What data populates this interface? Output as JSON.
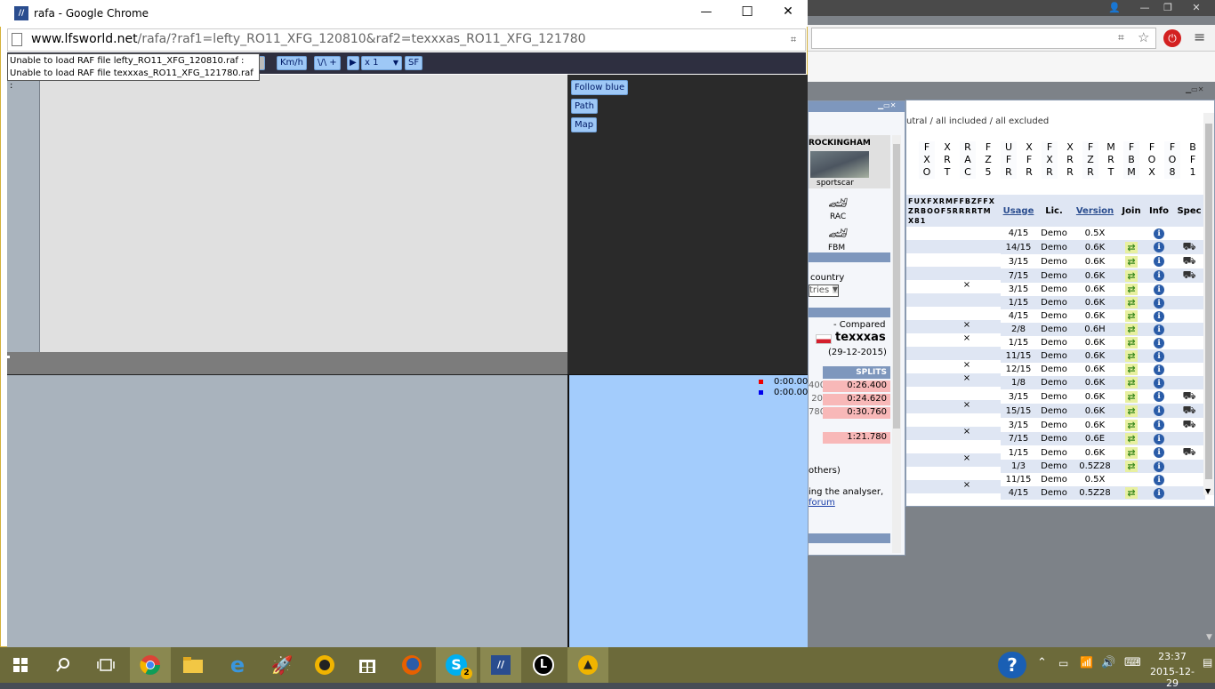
{
  "main_window": {
    "title": "rafa - Google Chrome",
    "url_host": "www.lfsworld.net",
    "url_path": "/rafa/?raf1=lefty_RO11_XFG_120810&raf2=texxxas_RO11_XFG_121780",
    "minimize": "—",
    "maximize": "☐",
    "close": "✕"
  },
  "errors": [
    "Unable to load RAF file lefty_RO11_XFG_120810.raf :",
    "Unable to load RAF file texxxas_RO11_XFG_121780.raf :"
  ],
  "toolbar": {
    "speed_unit": "Km/h",
    "graph_btn": "\\/\\ +",
    "play": "▶",
    "speed_select": "x 1",
    "sf": "SF"
  },
  "right_panel": {
    "follow_blue": "Follow blue",
    "path": "Path",
    "map": "Map",
    "timer_red": "0:00.00",
    "timer_blue": "0:00.00"
  },
  "bg_page": {
    "filter_text": "utral / all included / all excluded",
    "track_name": "ROCKINGHAM",
    "track_config": "sportscar",
    "car1": "RAC",
    "car2": "FBM",
    "country_label": "country",
    "country_select": "tries",
    "compared_label": "- Compared",
    "player_name": "texxxas",
    "date": "(29-12-2015)",
    "splits_header": "SPLITS",
    "splits_left": [
      "400",
      "20",
      "780"
    ],
    "splits": [
      "0:26.400",
      "0:24.620",
      "0:30.760"
    ],
    "total": "1:21.780",
    "others_text": "others)",
    "analyser_text": "ing the analyser,",
    "forum_link": "forum",
    "car_cols": [
      [
        "F",
        "X",
        "O"
      ],
      [
        "X",
        "R",
        "T"
      ],
      [
        "R",
        "A",
        "C"
      ],
      [
        "F",
        "Z",
        "5"
      ],
      [
        "U",
        "F",
        "R"
      ],
      [
        "X",
        "F",
        "R"
      ],
      [
        "F",
        "X",
        "R"
      ],
      [
        "X",
        "R",
        "R"
      ],
      [
        "F",
        "Z",
        "R"
      ],
      [
        "M",
        "R",
        "T"
      ],
      [
        "F",
        "B",
        "M"
      ],
      [
        "F",
        "O",
        "X"
      ],
      [
        "F",
        "O",
        "8"
      ],
      [
        "B",
        "F",
        "1"
      ]
    ],
    "small_hdr": [
      "F",
      "U",
      "X",
      "F",
      "X",
      "R",
      "M",
      "F",
      "F",
      "B",
      "Z",
      "F",
      "F",
      "X",
      "Z",
      "R",
      "B",
      "O",
      "O",
      "F",
      "5",
      "R",
      "R",
      "R",
      "R",
      "T",
      "M",
      "X",
      "8",
      "1"
    ],
    "col_usage": "Usage",
    "col_lic": "Lic.",
    "col_version": "Version",
    "col_join": "Join",
    "col_info": "Info",
    "col_spec": "Spec",
    "rows": [
      {
        "x": "",
        "usage": "4/15",
        "lic": "Demo",
        "ver": "0.5X",
        "join": false,
        "spec": false
      },
      {
        "x": "",
        "usage": "14/15",
        "lic": "Demo",
        "ver": "0.6K",
        "join": true,
        "spec": true
      },
      {
        "x": "",
        "usage": "3/15",
        "lic": "Demo",
        "ver": "0.6K",
        "join": true,
        "spec": true
      },
      {
        "x": "",
        "usage": "7/15",
        "lic": "Demo",
        "ver": "0.6K",
        "join": true,
        "spec": true
      },
      {
        "x": "×",
        "usage": "3/15",
        "lic": "Demo",
        "ver": "0.6K",
        "join": true,
        "spec": false
      },
      {
        "x": "",
        "usage": "1/15",
        "lic": "Demo",
        "ver": "0.6K",
        "join": true,
        "spec": false
      },
      {
        "x": "",
        "usage": "4/15",
        "lic": "Demo",
        "ver": "0.6K",
        "join": true,
        "spec": false
      },
      {
        "x": "×",
        "usage": "2/8",
        "lic": "Demo",
        "ver": "0.6H",
        "join": true,
        "spec": false
      },
      {
        "x": "×",
        "usage": "1/15",
        "lic": "Demo",
        "ver": "0.6K",
        "join": true,
        "spec": false
      },
      {
        "x": "",
        "usage": "11/15",
        "lic": "Demo",
        "ver": "0.6K",
        "join": true,
        "spec": false
      },
      {
        "x": "×",
        "usage": "12/15",
        "lic": "Demo",
        "ver": "0.6K",
        "join": true,
        "spec": false
      },
      {
        "x": "×",
        "usage": "1/8",
        "lic": "Demo",
        "ver": "0.6K",
        "join": true,
        "spec": false
      },
      {
        "x": "",
        "usage": "3/15",
        "lic": "Demo",
        "ver": "0.6K",
        "join": true,
        "spec": true
      },
      {
        "x": "×",
        "usage": "15/15",
        "lic": "Demo",
        "ver": "0.6K",
        "join": true,
        "spec": true
      },
      {
        "x": "",
        "usage": "3/15",
        "lic": "Demo",
        "ver": "0.6K",
        "join": true,
        "spec": true
      },
      {
        "x": "×",
        "usage": "7/15",
        "lic": "Demo",
        "ver": "0.6E",
        "join": true,
        "spec": false
      },
      {
        "x": "",
        "usage": "1/15",
        "lic": "Demo",
        "ver": "0.6K",
        "join": true,
        "spec": true
      },
      {
        "x": "×",
        "usage": "1/3",
        "lic": "Demo",
        "ver": "0.5Z28",
        "join": true,
        "spec": false
      },
      {
        "x": "",
        "usage": "11/15",
        "lic": "Demo",
        "ver": "0.5X",
        "join": false,
        "spec": false
      },
      {
        "x": "×",
        "usage": "4/15",
        "lic": "Demo",
        "ver": "0.5Z28",
        "join": true,
        "spec": false
      }
    ]
  },
  "taskbar": {
    "time": "23:37",
    "date": "2015-12-29",
    "skype_badge": "2",
    "help": "?"
  },
  "colors": {
    "accent_button": "#9ec8f6",
    "taskbar": "#6c6a3a",
    "lfs_blue": "#7e97bd"
  }
}
